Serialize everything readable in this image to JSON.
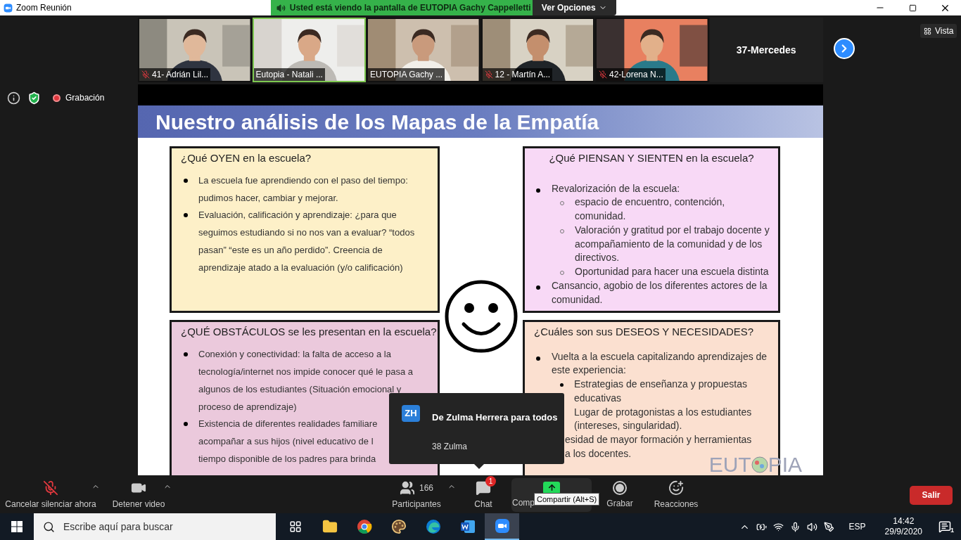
{
  "window": {
    "title": "Zoom Reunión"
  },
  "share_banner": {
    "text": "Usted está viendo la pantalla de EUTOPIA Gachy Cappelletti",
    "options": "Ver Opciones"
  },
  "participants": [
    {
      "name": "41- Adrián Lil...",
      "kind": "video",
      "muted": true,
      "selected": false
    },
    {
      "name": "Eutopia - Natali ...",
      "kind": "video",
      "muted": false,
      "selected": true
    },
    {
      "name": "EUTOPIA Gachy ...",
      "kind": "video",
      "muted": false,
      "selected": false
    },
    {
      "name": "12 - Martín A...",
      "kind": "video",
      "muted": true,
      "selected": false
    },
    {
      "name": "42-Lorena N...",
      "kind": "video",
      "muted": true,
      "selected": false
    },
    {
      "name": "37-Mercedes",
      "kind": "name_only",
      "selected": false
    }
  ],
  "view_button": "Vista",
  "recording": {
    "label": "Grabación"
  },
  "slide": {
    "title": "Nuestro análisis de los Mapas de la Empatía",
    "cards": [
      {
        "kind": "spaced",
        "color": "#fdf0c8",
        "heading": "¿Qué OYEN en la escuela?",
        "items": [
          {
            "kind": "bullet",
            "lines": [
              "La escuela fue aprendiendo con el paso del tiempo:",
              "pudimos hacer, cambiar y mejorar."
            ]
          },
          {
            "kind": "bullet",
            "lines": [
              "Evaluación, calificación y aprendizaje: ¿para que",
              "seguimos estudiando si no nos van a evaluar? “todos",
              "pasan” “este es un año perdido”. Creencia de",
              "aprendizaje atado a la evaluación (y/o calificación)"
            ]
          }
        ]
      },
      {
        "kind": "centered",
        "color": "#f8d9f6",
        "heading": "¿Qué PIENSAN Y SIENTEN en la escuela?",
        "items": [
          {
            "kind": "bullet",
            "lines": [
              "Revalorización de la escuela:"
            ]
          },
          {
            "kind": "sub_hollow",
            "lines": [
              "espacio de encuentro, contención,",
              "comunidad."
            ]
          },
          {
            "kind": "sub_hollow",
            "lines": [
              "Valoración y gratitud por el trabajo docente y",
              "acompañamiento de la comunidad y de los",
              "directivos."
            ]
          },
          {
            "kind": "sub_hollow",
            "lines": [
              "Oportunidad para hacer una escuela distinta"
            ]
          },
          {
            "kind": "bullet",
            "lines": [
              "Cansancio, agobio de los diferentes actores de la",
              "comunidad."
            ]
          }
        ]
      },
      {
        "kind": "spaced",
        "color": "#ebc9dc",
        "heading": "¿QUÉ OBSTÁCULOS se les presentan en la escuela?",
        "items": [
          {
            "kind": "bullet",
            "lines": [
              "Conexión y conectividad: la falta de acceso a la",
              "tecnología/internet nos impide conocer qué le pasa a",
              "algunos de los estudiantes (Situación emocional y",
              "proceso de aprendizaje)"
            ]
          },
          {
            "kind": "bullet",
            "lines": [
              "Existencia de diferentes realidades familiare",
              "acompañar a sus hijos (nivel educativo de l",
              "tiempo disponible de los padres para brinda"
            ]
          }
        ]
      },
      {
        "kind": "compact",
        "color": "#fbe0d0",
        "heading": "¿Cuáles son sus DESEOS Y NECESIDADES?",
        "items": [
          {
            "kind": "bullet",
            "lines": [
              "Vuelta a la escuela capitalizando aprendizajes de",
              "este experiencia:"
            ]
          },
          {
            "kind": "sub_filled",
            "lines": [
              "Estrategias de enseñanza y propuestas",
              "educativas"
            ]
          },
          {
            "kind": "sub_covered",
            "lines": [
              "Lugar de protagonistas a los estudiantes",
              "(intereses, singularidad)."
            ]
          },
          {
            "kind": "covered",
            "lines": [
              "esidad de mayor formación y herramientas",
              "a los docentes."
            ]
          }
        ]
      }
    ],
    "logo": [
      "EUT",
      "PIA"
    ]
  },
  "chat_popup": {
    "initials": "ZH",
    "title": "De Zulma Herrera para todos",
    "message": "38 Zulma"
  },
  "toolbar": {
    "items": [
      {
        "kind": "mic",
        "label": "Cancelar silenciar ahora",
        "muted": true,
        "menu": true
      },
      {
        "kind": "video",
        "label": "Detener video",
        "menu": true
      },
      {
        "kind": "participants",
        "label": "Participantes",
        "count": "166",
        "menu": true
      },
      {
        "kind": "chat",
        "label": "Chat",
        "badge": "1",
        "menu": false
      },
      {
        "kind": "share",
        "label": "Comp",
        "menu": false
      },
      {
        "kind": "record",
        "label": "Grabar",
        "menu": false
      },
      {
        "kind": "reactions",
        "label": "Reacciones",
        "menu": false
      }
    ],
    "leave": "Salir",
    "tooltip": "Compartir (Alt+S)"
  },
  "taskbar": {
    "search": {
      "placeholder": "Escribe aquí para buscar"
    },
    "apps": [
      {
        "kind": "taskview",
        "selected": false
      },
      {
        "kind": "explorer",
        "selected": false
      },
      {
        "kind": "chrome",
        "selected": false
      },
      {
        "kind": "paint",
        "selected": false
      },
      {
        "kind": "edge",
        "selected": false
      },
      {
        "kind": "word",
        "selected": false
      },
      {
        "kind": "zoom",
        "selected": true
      }
    ],
    "language": "ESP",
    "time": "14:42",
    "date": "29/9/2020",
    "notifications": "1"
  }
}
